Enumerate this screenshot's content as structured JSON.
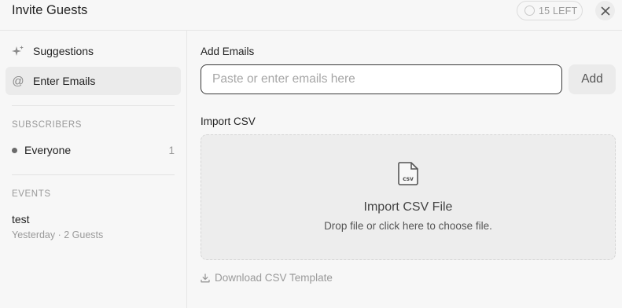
{
  "header": {
    "title": "Invite Guests",
    "quota_label": "15 LEFT"
  },
  "sidebar": {
    "nav": [
      {
        "label": "Suggestions",
        "icon": "sparkle-icon",
        "active": false
      },
      {
        "label": "Enter Emails",
        "icon": "at-icon",
        "active": true
      }
    ],
    "subscribers_heading": "SUBSCRIBERS",
    "subscribers": [
      {
        "label": "Everyone",
        "count": "1"
      }
    ],
    "events_heading": "EVENTS",
    "events": [
      {
        "name": "test",
        "meta": "Yesterday · 2 Guests"
      }
    ]
  },
  "main": {
    "add_emails_label": "Add Emails",
    "email_placeholder": "Paste or enter emails here",
    "email_value": "",
    "add_button": "Add",
    "import_label": "Import CSV",
    "dropzone_title": "Import CSV File",
    "dropzone_subtitle": "Drop file or click here to choose file.",
    "csv_icon_text": "csv",
    "download_label": "Download CSV Template"
  },
  "colors": {
    "background": "#f7f7f7",
    "active_nav": "#ebebeb",
    "dropzone_bg": "#ededed",
    "muted_text": "#9a9a9a"
  }
}
